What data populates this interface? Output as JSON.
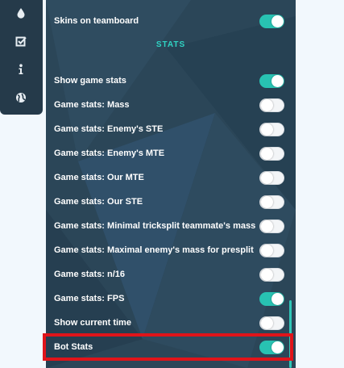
{
  "sidebar": {
    "icons": [
      "droplet-icon",
      "checkbox-icon",
      "info-icon",
      "globe-icon"
    ]
  },
  "panel": {
    "section_title": "STATS",
    "top_row": {
      "label": "Skins on teamboard",
      "on": true
    },
    "rows": [
      {
        "label": "Show game stats",
        "on": true
      },
      {
        "label": "Game stats: Mass",
        "on": false
      },
      {
        "label": "Game stats: Enemy's STE",
        "on": false
      },
      {
        "label": "Game stats: Enemy's MTE",
        "on": false
      },
      {
        "label": "Game stats: Our MTE",
        "on": false
      },
      {
        "label": "Game stats: Our STE",
        "on": false
      },
      {
        "label": "Game stats: Minimal tricksplit teammate's mass",
        "on": false
      },
      {
        "label": "Game stats: Maximal enemy's mass for presplit",
        "on": false
      },
      {
        "label": "Game stats: n/16",
        "on": false
      },
      {
        "label": "Game stats: FPS",
        "on": true
      },
      {
        "label": "Show current time",
        "on": false
      },
      {
        "label": "Bot Stats",
        "on": true
      }
    ]
  },
  "colors": {
    "panel_bg": "#2b4658",
    "accent": "#28c2b2",
    "highlight": "#e0141a"
  }
}
